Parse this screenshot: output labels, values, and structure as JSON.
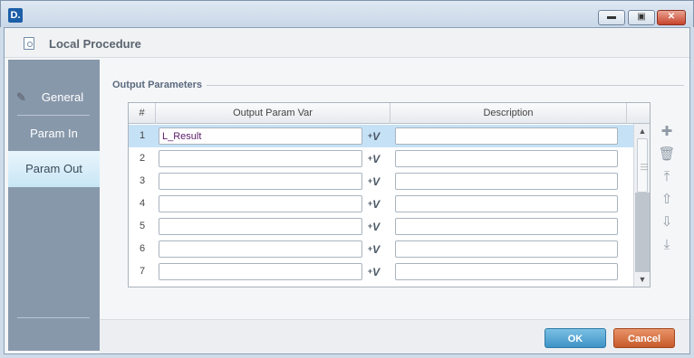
{
  "window": {
    "app_icon": "D.",
    "minimize_label": "▬",
    "maximize_label": "▣",
    "close_label": "✕"
  },
  "header": {
    "title": "Local Procedure",
    "icon": "document-icon"
  },
  "sidebar": {
    "items": [
      {
        "label": "General",
        "icon": "edit-icon"
      },
      {
        "label": "Param In"
      },
      {
        "label": "Param Out",
        "selected": true
      }
    ]
  },
  "section": {
    "title": "Output Parameters"
  },
  "grid": {
    "columns": [
      "#",
      "Output Param Var",
      "Description"
    ],
    "rows": [
      {
        "num": "1",
        "var": "L_Result",
        "desc": "",
        "selected": true
      },
      {
        "num": "2",
        "var": "",
        "desc": ""
      },
      {
        "num": "3",
        "var": "",
        "desc": ""
      },
      {
        "num": "4",
        "var": "",
        "desc": ""
      },
      {
        "num": "5",
        "var": "",
        "desc": ""
      },
      {
        "num": "6",
        "var": "",
        "desc": ""
      },
      {
        "num": "7",
        "var": "",
        "desc": ""
      }
    ],
    "var_button": "V"
  },
  "tools": [
    "add-icon",
    "delete-icon",
    "move-top-icon",
    "move-up-icon",
    "move-down-icon",
    "move-bottom-icon"
  ],
  "footer": {
    "ok_label": "OK",
    "cancel_label": "Cancel"
  },
  "colors": {
    "ok": "#3d93c6",
    "cancel": "#c65a2a",
    "selected_row": "#c5e1f6",
    "sidebar": "#8898ab"
  }
}
